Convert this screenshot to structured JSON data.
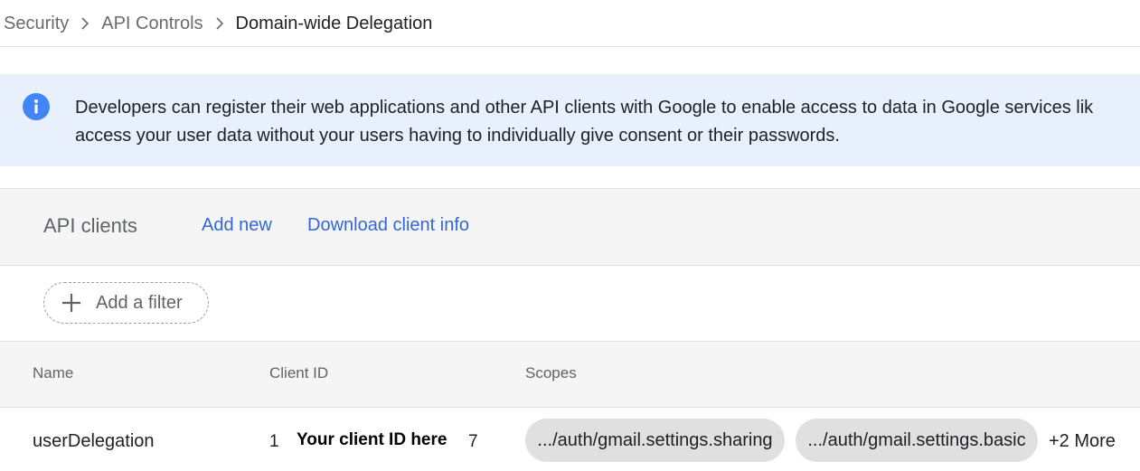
{
  "breadcrumb": {
    "items": [
      "Security",
      "API Controls"
    ],
    "current": "Domain-wide Delegation"
  },
  "banner": {
    "icon": "info-icon",
    "line1": "Developers can register their web applications and other API clients with Google to enable access to data in Google services lik",
    "line2": "access your user data without your users having to individually give consent or their passwords."
  },
  "clients": {
    "title": "API clients",
    "add_new": "Add new",
    "download": "Download client info"
  },
  "filter": {
    "label": "Add a filter",
    "icon": "plus-icon"
  },
  "table": {
    "headers": {
      "name": "Name",
      "client_id": "Client ID",
      "scopes": "Scopes"
    },
    "rows": [
      {
        "name": "userDelegation",
        "client_id_prefix": "1",
        "client_id_overlay": "Your client ID here",
        "client_id_suffix": "7",
        "scopes": [
          ".../auth/gmail.settings.sharing",
          ".../auth/gmail.settings.basic"
        ],
        "more": "+2 More"
      }
    ]
  },
  "colors": {
    "accent_link": "#3367d6",
    "banner_bg": "#e8f0fe",
    "info_icon": "#4285f4",
    "chip_bg": "#e0e0e0"
  }
}
